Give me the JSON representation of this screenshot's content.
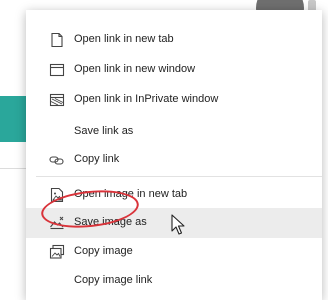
{
  "context_menu": {
    "items": [
      {
        "label": "Open link in new tab",
        "icon": "new-tab-icon"
      },
      {
        "label": "Open link in new window",
        "icon": "new-window-icon"
      },
      {
        "label": "Open link in InPrivate window",
        "icon": "inprivate-window-icon"
      },
      {
        "label": "Save link as",
        "icon": ""
      },
      {
        "label": "Copy link",
        "icon": "link-icon"
      },
      {
        "label": "Open image in new tab",
        "icon": "image-new-tab-icon"
      },
      {
        "label": "Save image as",
        "icon": "save-image-icon",
        "state": "hover",
        "annotated": true
      },
      {
        "label": "Copy image",
        "icon": "copy-image-icon"
      },
      {
        "label": "Copy image link",
        "icon": ""
      }
    ]
  },
  "colors": {
    "annotation": "#d9333a",
    "hover": "#ececec",
    "accent_background": "#2aa79b"
  }
}
